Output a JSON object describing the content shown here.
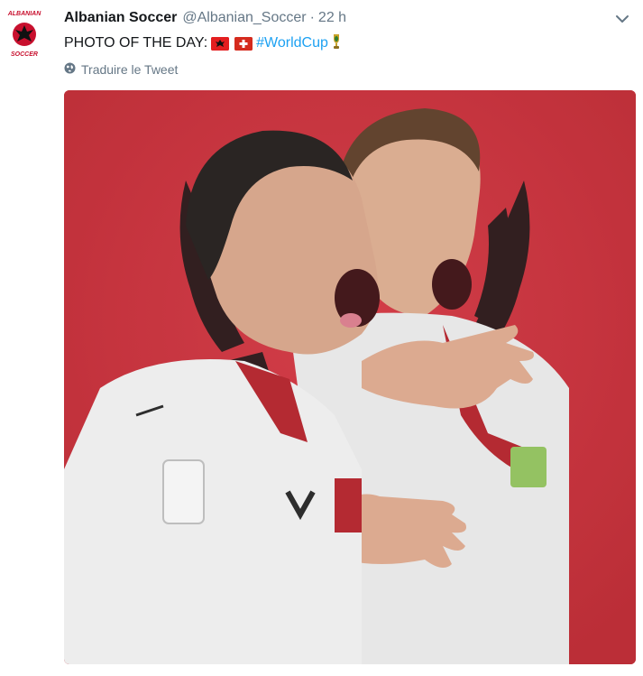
{
  "tweet": {
    "author_name": "Albanian Soccer",
    "author_handle": "@Albanian_Soccer",
    "separator": "·",
    "time": "22 h",
    "text_prefix": "PHOTO OF THE DAY:",
    "hashtag": "#WorldCup",
    "translate_label": "Traduire le Tweet"
  },
  "avatar": {
    "logo_text_top": "ALBANIAN",
    "logo_text_bottom": "SOCCER"
  },
  "icons": {
    "caret": "chevron-down-icon",
    "globe": "globe-icon",
    "flag_1": "albania-flag-icon",
    "flag_2": "switzerland-flag-icon",
    "trophy": "trophy-icon"
  },
  "colors": {
    "link": "#1da1f2",
    "secondary_text": "#657786",
    "media_background": "#c82a35"
  }
}
